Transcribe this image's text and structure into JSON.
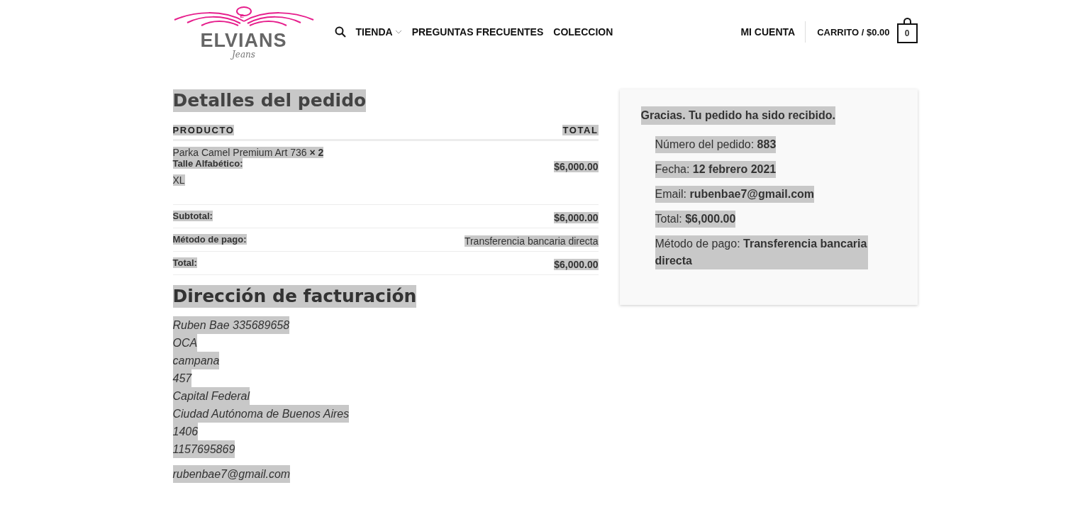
{
  "selection_highlight": true,
  "header": {
    "logo": {
      "brand": "ELVIANS",
      "tagline": "Jeans",
      "badge": "E"
    },
    "nav": [
      {
        "label": "TIENDA",
        "dropdown": true
      },
      {
        "label": "PREGUNTAS FRECUENTES",
        "dropdown": false
      },
      {
        "label": "COLECCION",
        "dropdown": false
      }
    ],
    "account": "MI CUENTA",
    "cart": "CARRITO / $0.00",
    "cart_count": "0"
  },
  "order_details": {
    "title": "Detalles del pedido",
    "columns": [
      "PRODUCTO",
      "TOTAL"
    ],
    "items": [
      {
        "name": "Parka Camel Premium Art 736 **× 2**",
        "meta_label": "Talle Alfabético:",
        "meta_value": "XL",
        "total": "$6,000.00"
      }
    ],
    "totals": [
      {
        "label": "Subtotal:",
        "value": "$6,000.00",
        "kind": "bold"
      },
      {
        "label": "Método de pago:",
        "value": "Transferencia bancaria directa",
        "kind": "plain"
      },
      {
        "label": "Total:",
        "value": "$6,000.00",
        "kind": "bold"
      }
    ]
  },
  "billing": {
    "title": "Dirección de facturación",
    "lines": [
      "Ruben Bae 335689658",
      "OCA",
      "campana",
      "457",
      "Capital Federal",
      "Ciudad Autónoma de Buenos Aires",
      "1406",
      "1157695869"
    ],
    "email": "rubenbae7@gmail.com"
  },
  "summary": {
    "notice": "Gracias. Tu pedido ha sido recibido.",
    "items": [
      "Número del pedido: **883**",
      "Fecha: **12 febrero 2021**",
      "Email: **rubenbae7@gmail.com**",
      "Total: **$6,000.00**",
      "Método de pago: **Transferencia bancaria directa**"
    ]
  }
}
